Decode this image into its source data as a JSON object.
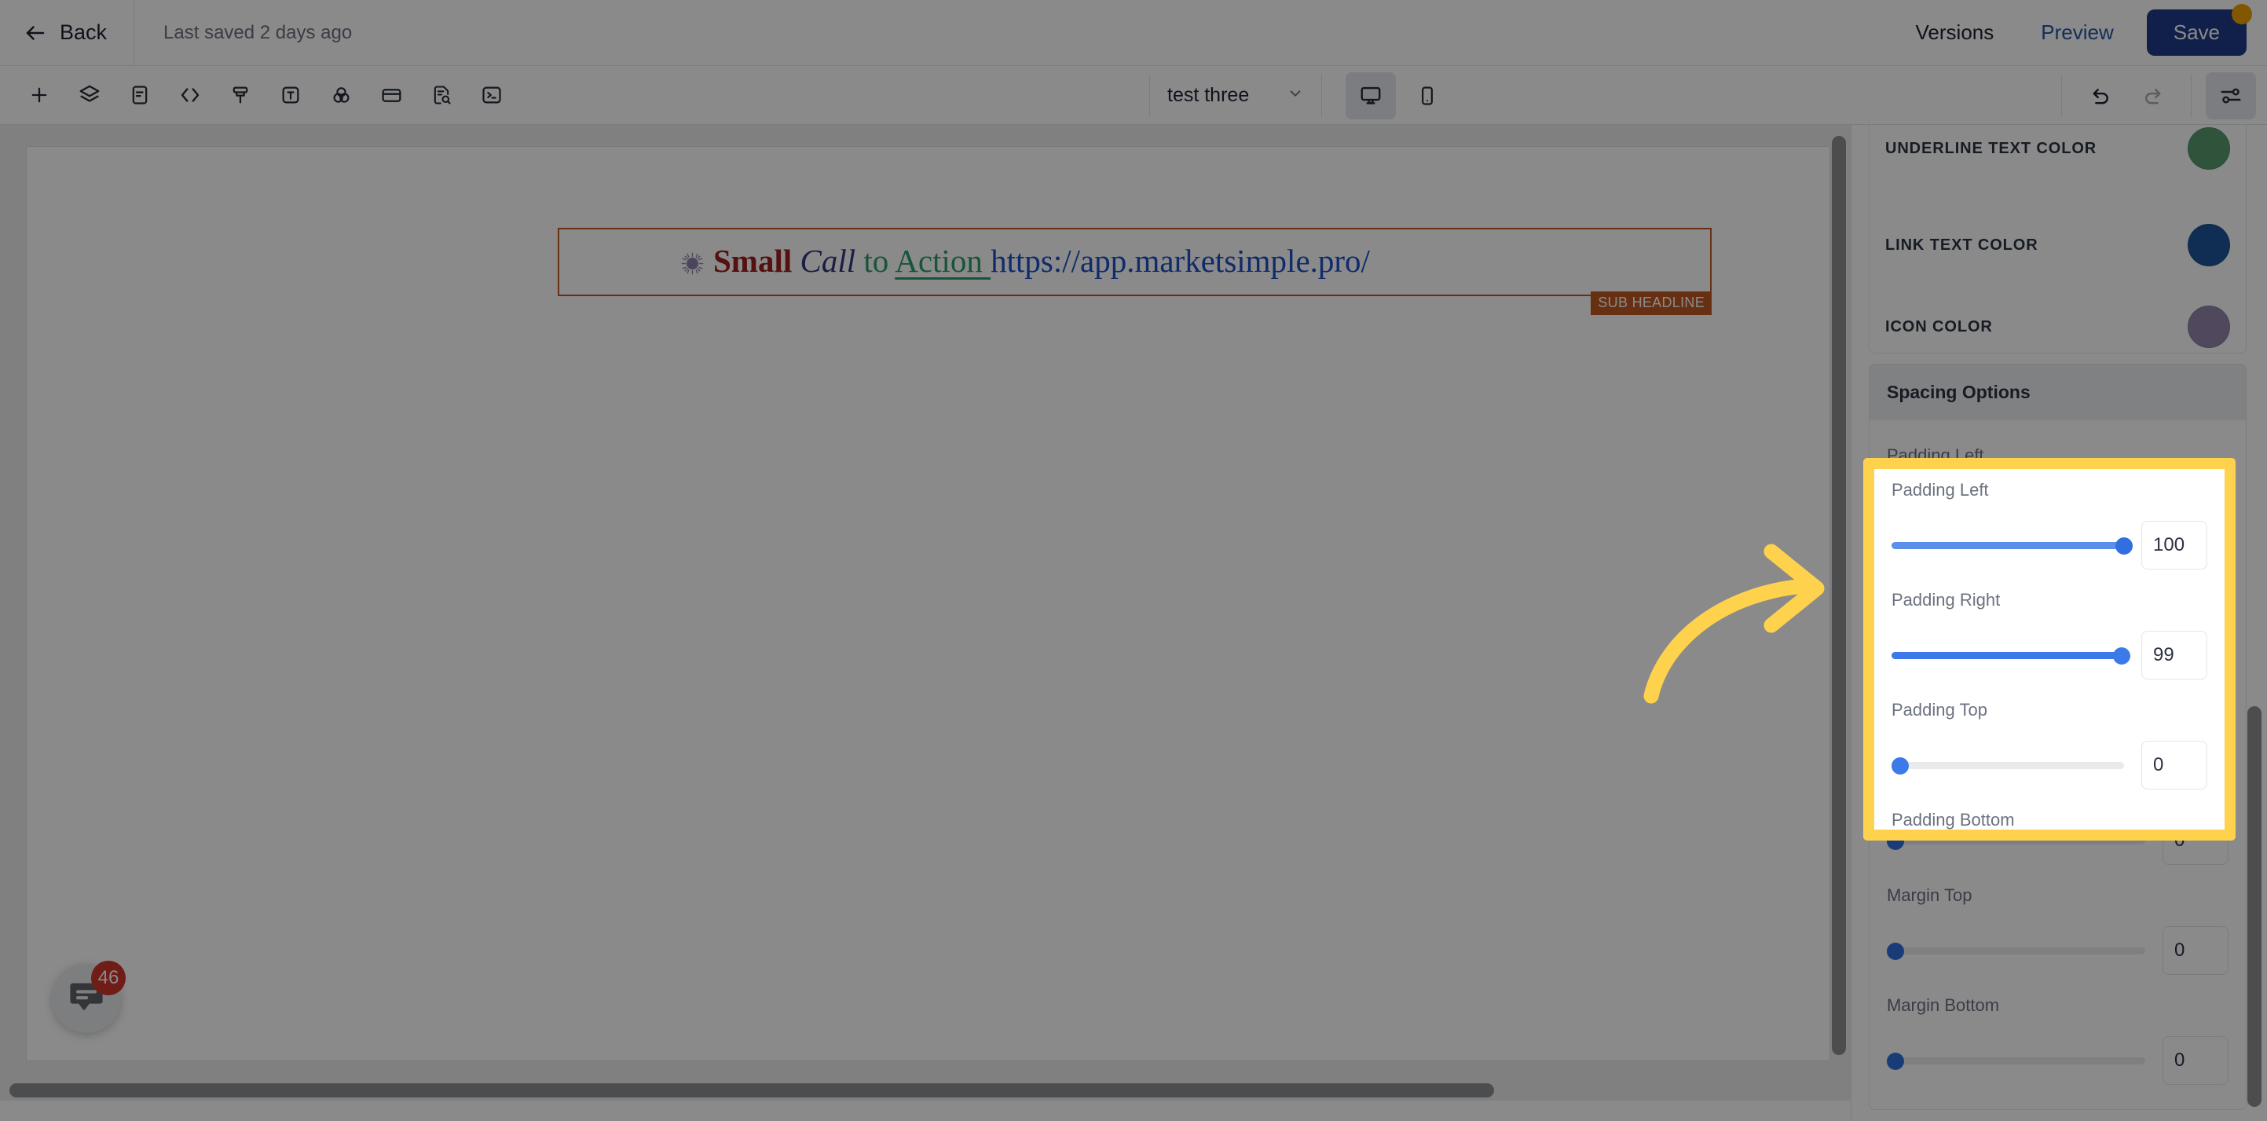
{
  "topbar": {
    "back_label": "Back",
    "back_icon": "arrow-left-icon",
    "last_saved": "Last saved 2 days ago",
    "versions_label": "Versions",
    "preview_label": "Preview",
    "save_label": "Save",
    "save_badge_color": "#f0a202"
  },
  "toolbar": {
    "left_tools": [
      {
        "name": "add-icon",
        "label": "Add"
      },
      {
        "name": "layers-icon",
        "label": "Layers"
      },
      {
        "name": "document-icon",
        "label": "Content"
      },
      {
        "name": "code-icon",
        "label": "Code"
      },
      {
        "name": "paint-brush-icon",
        "label": "Design"
      },
      {
        "name": "text-icon",
        "label": "Text"
      },
      {
        "name": "color-circles-icon",
        "label": "Colors"
      },
      {
        "name": "card-icon",
        "label": "Container"
      },
      {
        "name": "document-search-icon",
        "label": "SEO"
      },
      {
        "name": "terminal-icon",
        "label": "Console"
      }
    ],
    "page_select_value": "test three",
    "page_select_icon": "chevron-down-icon",
    "devices": [
      {
        "name": "desktop-icon",
        "label": "Desktop",
        "selected": true
      },
      {
        "name": "mobile-icon",
        "label": "Mobile",
        "selected": false
      }
    ],
    "undo_icon": "undo-icon",
    "redo_icon": "redo-icon",
    "settings_icon": "sliders-icon"
  },
  "canvas": {
    "block_badge": "SUB HEADLINE",
    "text": {
      "icon": "sun-burst-icon",
      "small": "Small",
      "call": "Call",
      "to": " to ",
      "action": "Action ",
      "url": " https://app.marketsimple.pro/"
    },
    "chat": {
      "icon": "chat-bubble-icon",
      "badge_count": "46"
    }
  },
  "right_panel": {
    "color_options": [
      {
        "label": "UNDERLINE TEXT COLOR",
        "color": "#5a9c6e",
        "swatch_name": "underline-text-color-swatch"
      },
      {
        "label": "LINK TEXT COLOR",
        "color": "#1f5599",
        "swatch_name": "link-text-color-swatch"
      },
      {
        "label": "ICON COLOR",
        "color": "#9487ad",
        "swatch_name": "icon-color-swatch"
      }
    ],
    "spacing": {
      "title": "Spacing Options",
      "controls": [
        {
          "label": "Padding Left",
          "value": "100",
          "percent": 100,
          "highlighted": true
        },
        {
          "label": "Padding Right",
          "value": "99",
          "percent": 99,
          "highlighted": true
        },
        {
          "label": "Padding Top",
          "value": "0",
          "percent": 0,
          "highlighted": true
        },
        {
          "label": "Padding Bottom",
          "value": "0",
          "percent": 0,
          "highlighted": true
        },
        {
          "label": "Margin Top",
          "value": "0",
          "percent": 0,
          "highlighted": false
        },
        {
          "label": "Margin Bottom",
          "value": "0",
          "percent": 0,
          "highlighted": false
        }
      ]
    }
  },
  "annotation": {
    "highlight_color": "#ffd24d",
    "arrow_name": "curved-arrow-annotation"
  }
}
